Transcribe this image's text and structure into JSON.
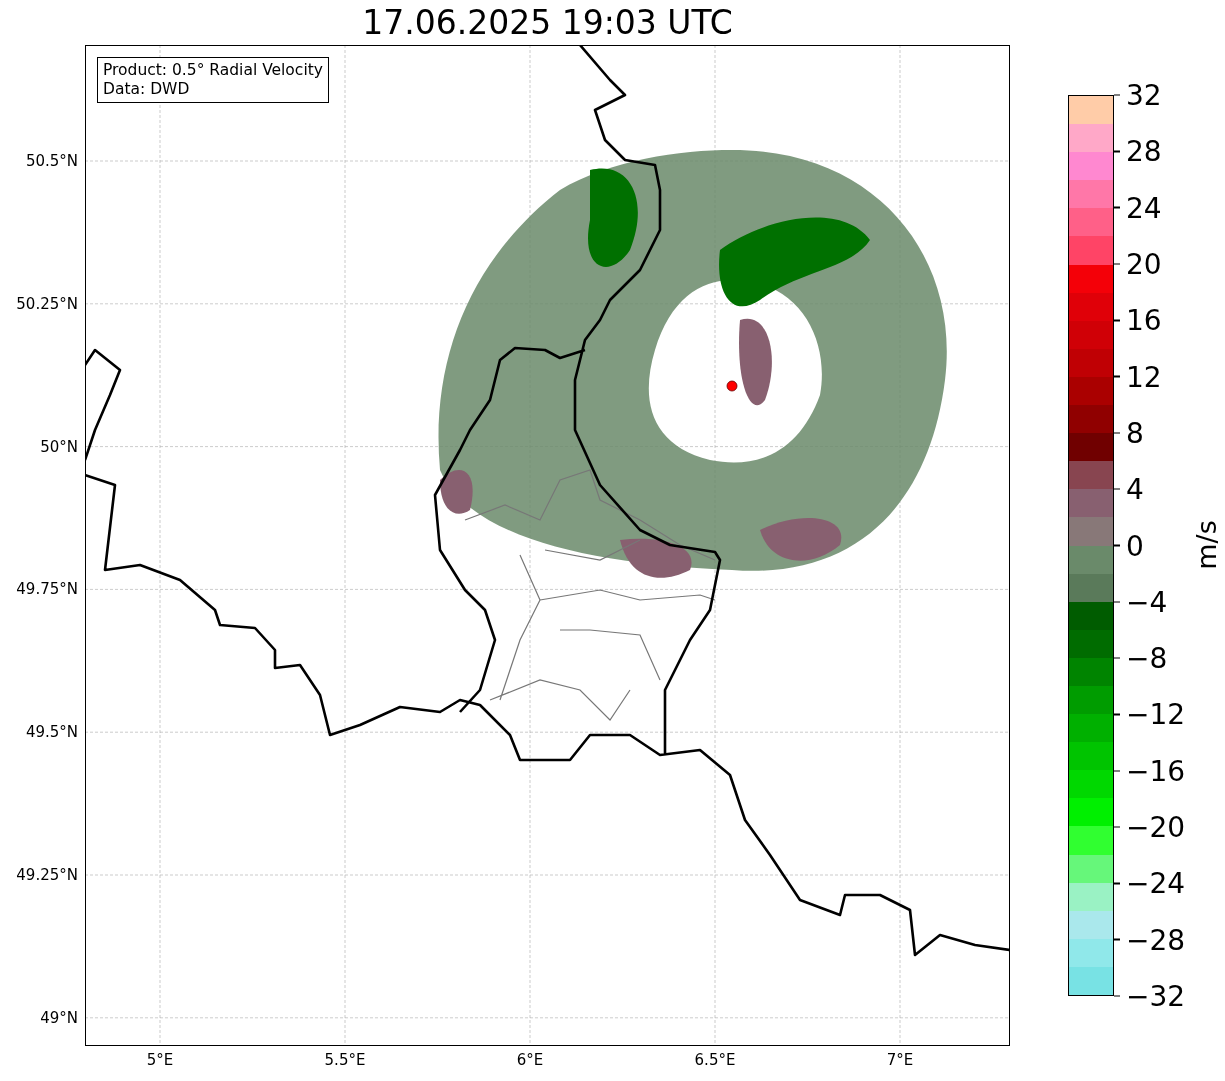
{
  "title": "17.06.2025 19:03 UTC",
  "legend": [
    "Product: 0.5° Radial Velocity",
    "Data: DWD"
  ],
  "y_ticks": [
    "50.5°N",
    "50.25°N",
    "50°N",
    "49.75°N",
    "49.5°N",
    "49.25°N",
    "49°N"
  ],
  "x_ticks": [
    "5°E",
    "5.5°E",
    "6°E",
    "6.5°E",
    "7°E"
  ],
  "colorbar": {
    "label": "m/s",
    "ticks": [
      "32",
      "28",
      "24",
      "20",
      "16",
      "12",
      "8",
      "4",
      "0",
      "−4",
      "−8",
      "−12",
      "−16",
      "−20",
      "−24",
      "−28",
      "−32"
    ],
    "bands": [
      {
        "color": "#ffcca8"
      },
      {
        "color": "#ffa8c8"
      },
      {
        "color": "#ff88d0"
      },
      {
        "color": "#ff77a8"
      },
      {
        "color": "#ff6088"
      },
      {
        "color": "#ff4466"
      },
      {
        "color": "#f40008"
      },
      {
        "color": "#e00008"
      },
      {
        "color": "#d00006"
      },
      {
        "color": "#c00004"
      },
      {
        "color": "#aa0000"
      },
      {
        "color": "#900000"
      },
      {
        "color": "#700000"
      },
      {
        "color": "#884550"
      },
      {
        "color": "#886070"
      },
      {
        "color": "#887878"
      },
      {
        "color": "#6a8a6a"
      },
      {
        "color": "#5a7a5a"
      },
      {
        "color": "#005c00"
      },
      {
        "color": "#006c00"
      },
      {
        "color": "#008400"
      },
      {
        "color": "#009c00"
      },
      {
        "color": "#00b000"
      },
      {
        "color": "#00c400"
      },
      {
        "color": "#00d800"
      },
      {
        "color": "#00f000"
      },
      {
        "color": "#30ff30"
      },
      {
        "color": "#66f77a"
      },
      {
        "color": "#9af2c4"
      },
      {
        "color": "#aae8ec"
      },
      {
        "color": "#90e8ea"
      },
      {
        "color": "#78e2e4"
      }
    ]
  }
}
